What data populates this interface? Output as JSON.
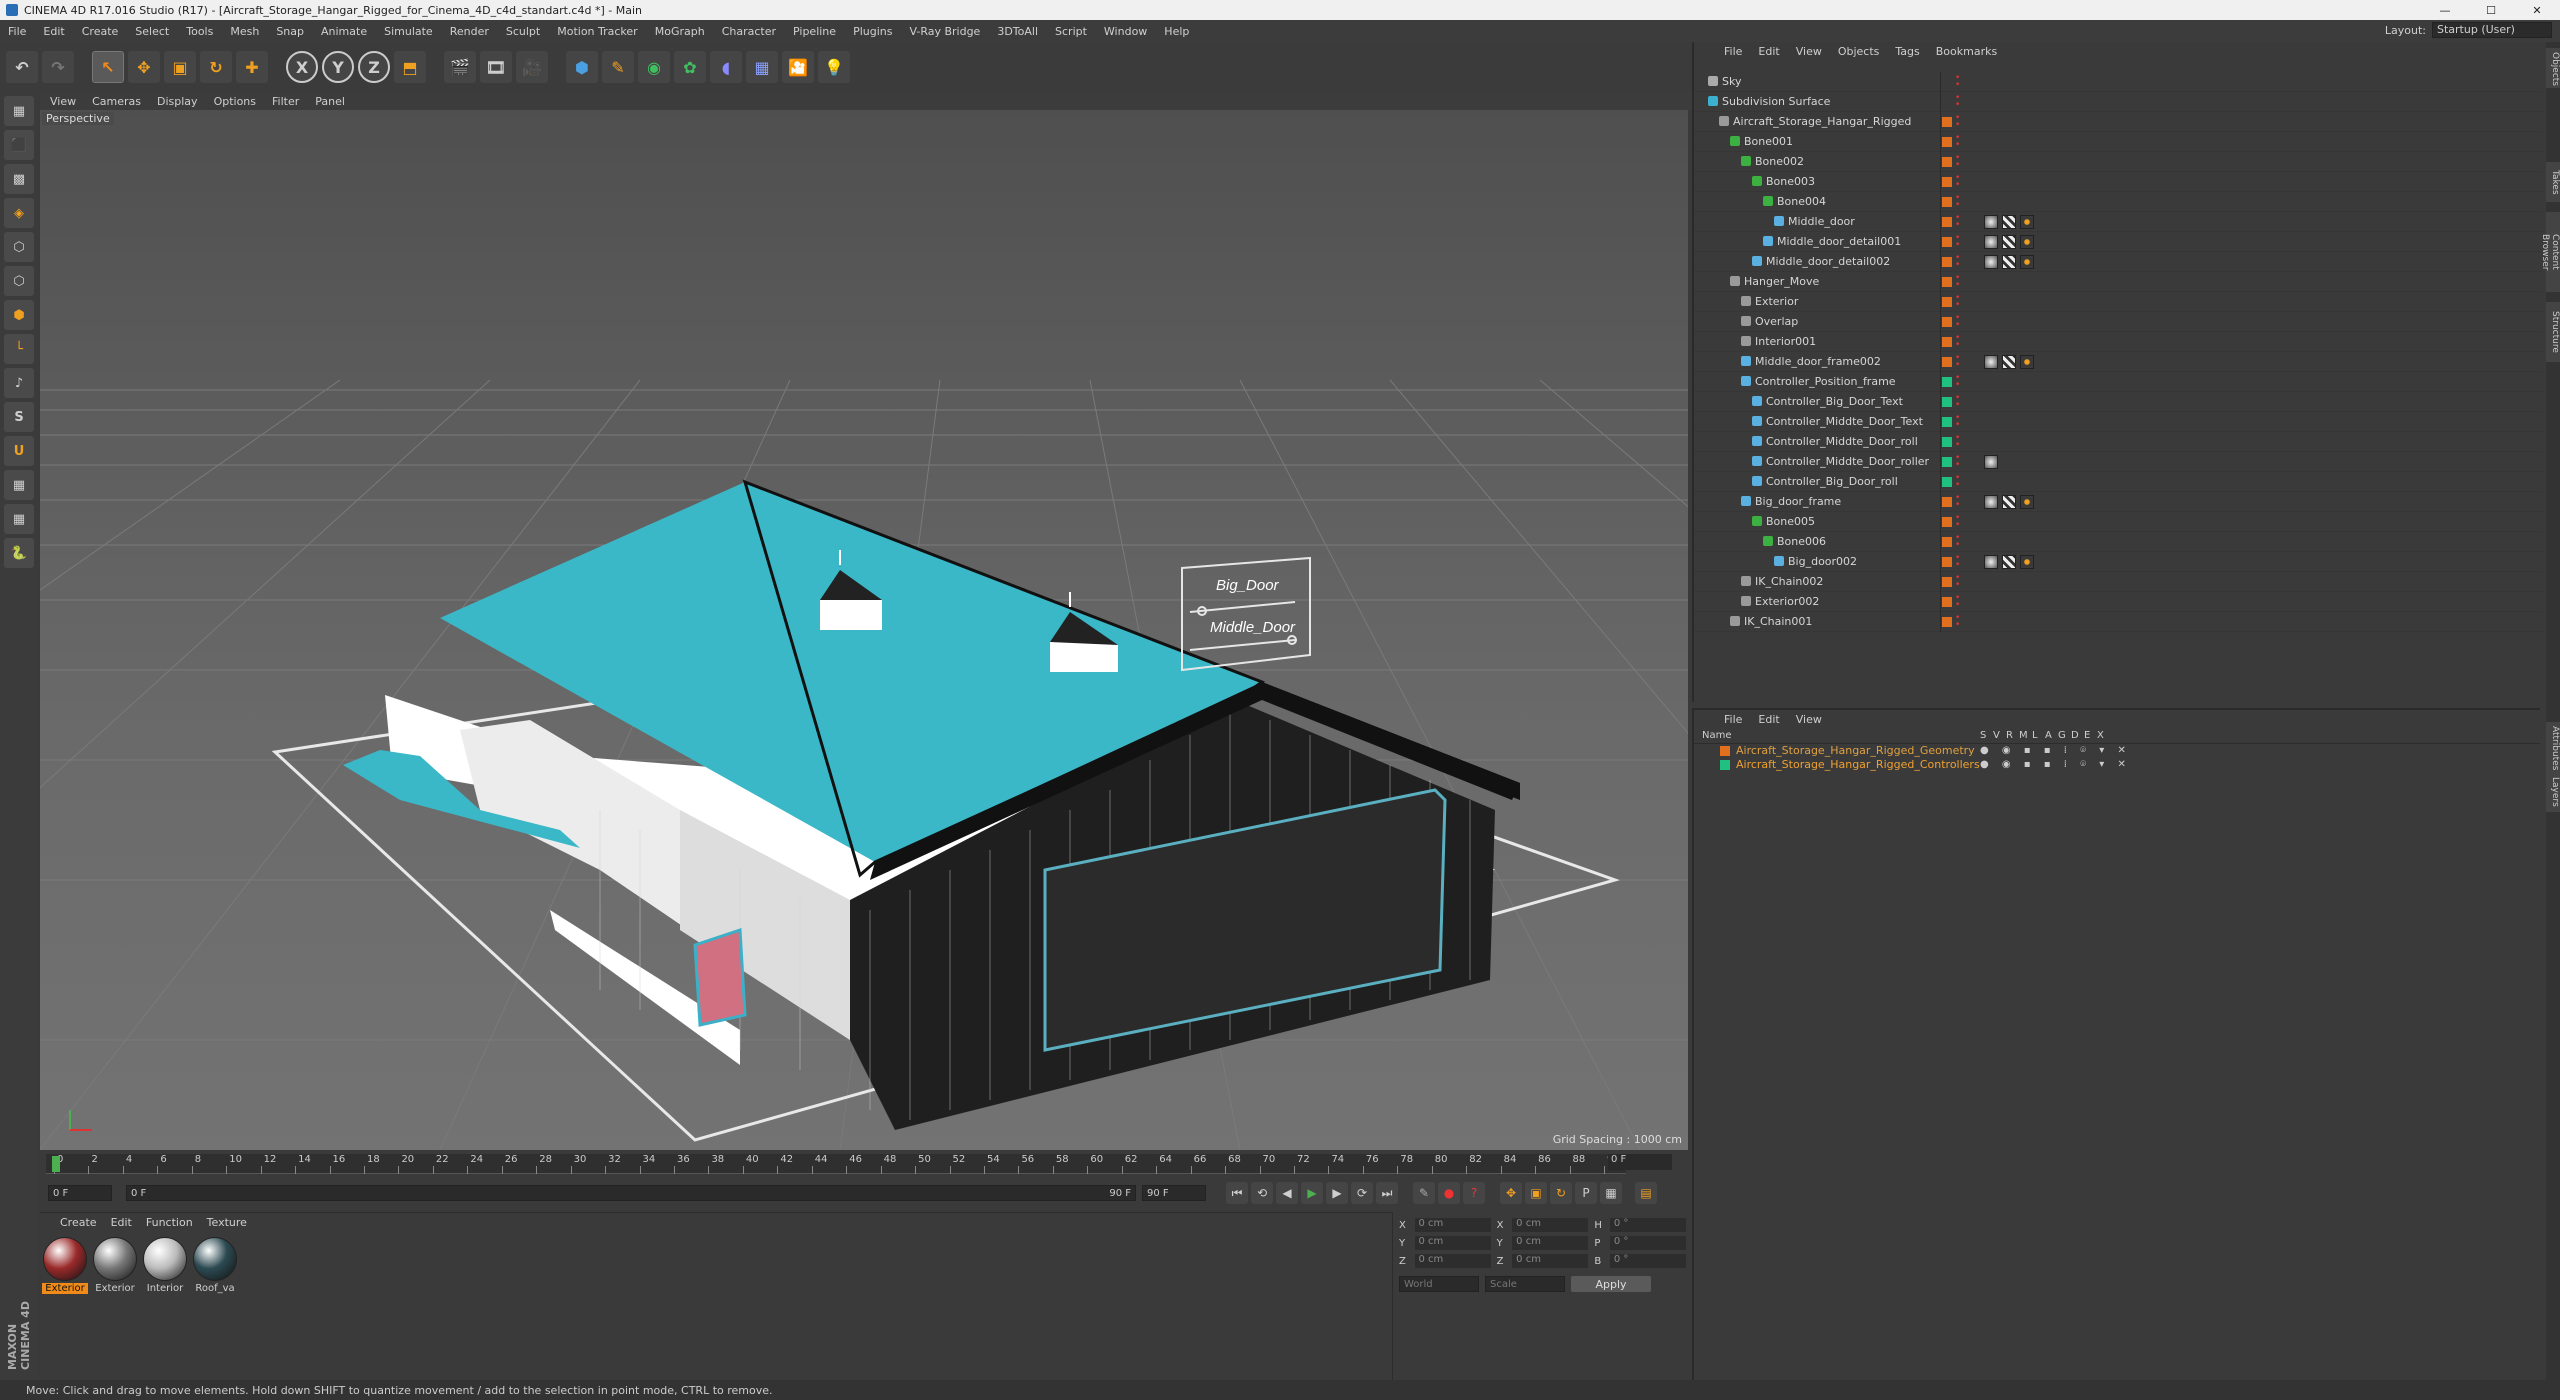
{
  "title": "CINEMA 4D R17.016 Studio (R17) - [Aircraft_Storage_Hangar_Rigged_for_Cinema_4D_c4d_standart.c4d *] - Main",
  "menubar": [
    "File",
    "Edit",
    "Create",
    "Select",
    "Tools",
    "Mesh",
    "Snap",
    "Animate",
    "Simulate",
    "Render",
    "Sculpt",
    "Motion Tracker",
    "MoGraph",
    "Character",
    "Pipeline",
    "Plugins",
    "V-Ray Bridge",
    "3DToAll",
    "Script",
    "Window",
    "Help"
  ],
  "layout": {
    "label": "Layout:",
    "value": "Startup (User)"
  },
  "toolbar": {
    "undo": "↶",
    "redo": "↷",
    "x": "X",
    "y": "Y",
    "z": "Z"
  },
  "viewport": {
    "menu": [
      "View",
      "Cameras",
      "Display",
      "Options",
      "Filter",
      "Panel"
    ],
    "label": "Perspective",
    "grid_spacing": "Grid Spacing : 1000 cm",
    "sign_big_door": "Big_Door",
    "sign_middle_door": "Middle_Door"
  },
  "timeline": {
    "ticks": [
      "0",
      "2",
      "4",
      "6",
      "8",
      "10",
      "12",
      "14",
      "16",
      "18",
      "20",
      "22",
      "24",
      "26",
      "28",
      "30",
      "32",
      "34",
      "36",
      "38",
      "40",
      "42",
      "44",
      "46",
      "48",
      "50",
      "52",
      "54",
      "56",
      "58",
      "60",
      "62",
      "64",
      "66",
      "68",
      "70",
      "72",
      "74",
      "76",
      "78",
      "80",
      "82",
      "84",
      "86",
      "88",
      "90"
    ],
    "current_frame": "0 F",
    "start_field": "0 F",
    "range_start": "0 F",
    "range_end": "90 F",
    "end_field": "90 F"
  },
  "materials": {
    "menu": [
      "Create",
      "Edit",
      "Function",
      "Texture"
    ],
    "items": [
      {
        "label": "Exterior",
        "color": "#9a2a2a",
        "selected": true
      },
      {
        "label": "Exterior",
        "color": "#777777",
        "selected": false
      },
      {
        "label": "Interior",
        "color": "#bbbbbb",
        "selected": false
      },
      {
        "label": "Roof_va",
        "color": "#2c4a52",
        "selected": false
      }
    ]
  },
  "coords": {
    "rows": [
      {
        "a": "X",
        "av": "0 cm",
        "b": "X",
        "bv": "0 cm",
        "c": "H",
        "cv": "0 °"
      },
      {
        "a": "Y",
        "av": "0 cm",
        "b": "Y",
        "bv": "0 cm",
        "c": "P",
        "cv": "0 °"
      },
      {
        "a": "Z",
        "av": "0 cm",
        "b": "Z",
        "bv": "0 cm",
        "c": "B",
        "cv": "0 °"
      }
    ],
    "world": "World",
    "scale": "Scale",
    "apply": "Apply"
  },
  "maxon": "MAXON CINEMA 4D",
  "status": "Move: Click and drag to move elements. Hold down SHIFT to quantize movement / add to the selection in point mode, CTRL to remove.",
  "objmgr": {
    "menu": [
      "File",
      "Edit",
      "View",
      "Objects",
      "Tags",
      "Bookmarks"
    ],
    "rows": [
      {
        "name": "Sky",
        "depth": 0,
        "icon": "#aaaaaa",
        "sw": "",
        "tags": 0
      },
      {
        "name": "Subdivision Surface",
        "depth": 0,
        "icon": "#3bb0d0",
        "sw": "",
        "tags": 0
      },
      {
        "name": "Aircraft_Storage_Hangar_Rigged",
        "depth": 1,
        "icon": "#9a9a9a",
        "sw": "#e07020",
        "tags": 0
      },
      {
        "name": "Bone001",
        "depth": 2,
        "icon": "#3cb040",
        "sw": "#e07020",
        "tags": 0
      },
      {
        "name": "Bone002",
        "depth": 3,
        "icon": "#3cb040",
        "sw": "#e07020",
        "tags": 0
      },
      {
        "name": "Bone003",
        "depth": 4,
        "icon": "#3cb040",
        "sw": "#e07020",
        "tags": 0
      },
      {
        "name": "Bone004",
        "depth": 5,
        "icon": "#3cb040",
        "sw": "#e07020",
        "tags": 0
      },
      {
        "name": "Middle_door",
        "depth": 6,
        "icon": "#5ab0e0",
        "sw": "#e07020",
        "tags": 3
      },
      {
        "name": "Middle_door_detail001",
        "depth": 5,
        "icon": "#5ab0e0",
        "sw": "#e07020",
        "tags": 3
      },
      {
        "name": "Middle_door_detail002",
        "depth": 4,
        "icon": "#5ab0e0",
        "sw": "#e07020",
        "tags": 3
      },
      {
        "name": "Hanger_Move",
        "depth": 2,
        "icon": "#9a9a9a",
        "sw": "#e07020",
        "tags": 0
      },
      {
        "name": "Exterior",
        "depth": 3,
        "icon": "#9a9a9a",
        "sw": "#e07020",
        "tags": 0
      },
      {
        "name": "Overlap",
        "depth": 3,
        "icon": "#9a9a9a",
        "sw": "#e07020",
        "tags": 0
      },
      {
        "name": "Interior001",
        "depth": 3,
        "icon": "#9a9a9a",
        "sw": "#e07020",
        "tags": 0
      },
      {
        "name": "Middle_door_frame002",
        "depth": 3,
        "icon": "#5ab0e0",
        "sw": "#e07020",
        "tags": 3
      },
      {
        "name": "Controller_Position_frame",
        "depth": 3,
        "icon": "#5ab0e0",
        "sw": "#20c080",
        "tags": 0
      },
      {
        "name": "Controller_Big_Door_Text",
        "depth": 4,
        "icon": "#5ab0e0",
        "sw": "#20c080",
        "tags": 0
      },
      {
        "name": "Controller_Middte_Door_Text",
        "depth": 4,
        "icon": "#5ab0e0",
        "sw": "#20c080",
        "tags": 0
      },
      {
        "name": "Controller_Middte_Door_roll",
        "depth": 4,
        "icon": "#5ab0e0",
        "sw": "#20c080",
        "tags": 0
      },
      {
        "name": "Controller_Middte_Door_roller",
        "depth": 4,
        "icon": "#5ab0e0",
        "sw": "#20c080",
        "tags": 1
      },
      {
        "name": "Controller_Big_Door_roll",
        "depth": 4,
        "icon": "#5ab0e0",
        "sw": "#20c080",
        "tags": 0
      },
      {
        "name": "Big_door_frame",
        "depth": 3,
        "icon": "#5ab0e0",
        "sw": "#e07020",
        "tags": 3
      },
      {
        "name": "Bone005",
        "depth": 4,
        "icon": "#3cb040",
        "sw": "#e07020",
        "tags": 0
      },
      {
        "name": "Bone006",
        "depth": 5,
        "icon": "#3cb040",
        "sw": "#e07020",
        "tags": 0
      },
      {
        "name": "Big_door002",
        "depth": 6,
        "icon": "#5ab0e0",
        "sw": "#e07020",
        "tags": 3
      },
      {
        "name": "IK_Chain002",
        "depth": 3,
        "icon": "#9a9a9a",
        "sw": "#e07020",
        "tags": 0
      },
      {
        "name": "Exterior002",
        "depth": 3,
        "icon": "#9a9a9a",
        "sw": "#e07020",
        "tags": 0
      },
      {
        "name": "IK_Chain001",
        "depth": 2,
        "icon": "#9a9a9a",
        "sw": "#e07020",
        "tags": 0
      }
    ]
  },
  "layermgr": {
    "menu": [
      "File",
      "Edit",
      "View"
    ],
    "header": {
      "name": "Name",
      "flags": [
        "S",
        "V",
        "R",
        "M",
        "L",
        "A",
        "G",
        "D",
        "E",
        "X"
      ]
    },
    "rows": [
      {
        "name": "Aircraft_Storage_Hangar_Rigged_Geometry",
        "color": "#e07020",
        "textcolor": "#e0a040"
      },
      {
        "name": "Aircraft_Storage_Hangar_Rigged_Controllers",
        "color": "#20c080",
        "textcolor": "#f0a030"
      }
    ]
  },
  "right_tabs": [
    "Objects",
    "Takes",
    "Content Browser",
    "Structure",
    "Attributes",
    "Layers"
  ]
}
